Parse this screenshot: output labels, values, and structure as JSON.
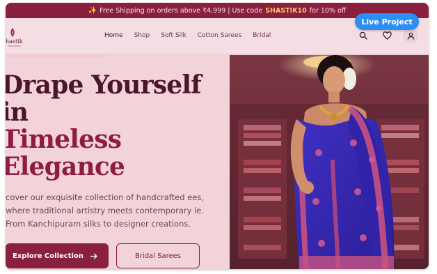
{
  "promo": {
    "spark_icon": "sparkle-icon",
    "text": "Free Shipping on orders above ₹4,999 | Use code",
    "code": "SHASTIK10",
    "suffix": "for 10% off"
  },
  "brand": {
    "name": "hastik"
  },
  "nav": {
    "items": [
      {
        "label": "Home"
      },
      {
        "label": "Shop"
      },
      {
        "label": "Soft Silk"
      },
      {
        "label": "Cotton Sarees"
      },
      {
        "label": "Bridal"
      }
    ],
    "icons": [
      "search-icon",
      "heart-icon",
      "user-icon"
    ]
  },
  "live_badge": "Live Project",
  "hero": {
    "line1": "Drape Yourself",
    "line2": "in",
    "line3": "Timeless",
    "line4": "Elegance",
    "subcopy": "cover our exquisite collection of handcrafted ees, where traditional artistry meets contemporary le. From Kanchipuram silks to designer creations.",
    "primary_cta": "Explore Collection",
    "secondary_cta": "Bridal Sarees"
  },
  "colors": {
    "maroon": "#8a1f3e",
    "blush": "#f2d2d9",
    "promo_code": "#ffc36b",
    "live_blue": "#2d8ff2",
    "saree_blue": "#3b2bb0"
  }
}
